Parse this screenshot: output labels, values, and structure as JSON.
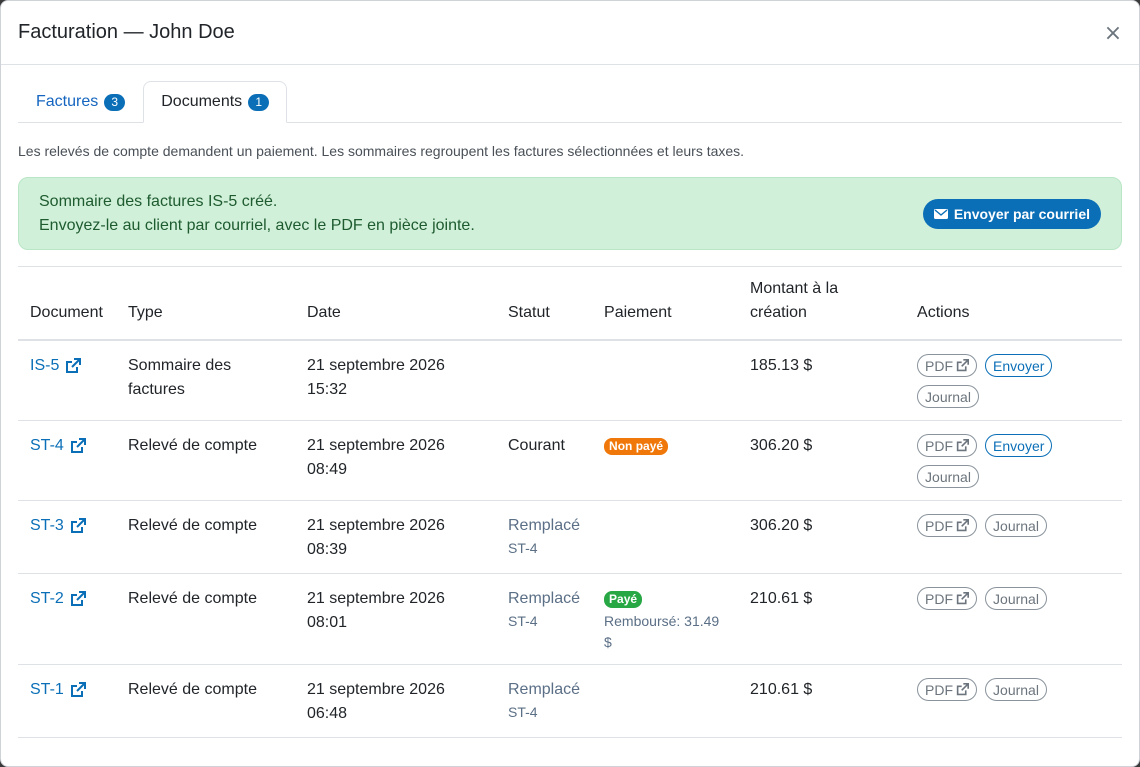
{
  "modal": {
    "title": "Facturation — John Doe",
    "close_label": "×"
  },
  "tabs": [
    {
      "label": "Factures",
      "count": "3"
    },
    {
      "label": "Documents",
      "count": "1"
    }
  ],
  "help_text": "Les relevés de compte demandent un paiement. Les sommaires regroupent les factures sélectionnées et leurs taxes.",
  "alert": {
    "line1": "Sommaire des factures IS-5 créé.",
    "line2": "Envoyez-le au client par courriel, avec le PDF en pièce jointe.",
    "button_label": "Envoyer par courriel"
  },
  "table": {
    "headers": {
      "document": "Document",
      "type": "Type",
      "date": "Date",
      "status": "Statut",
      "payment": "Paiement",
      "amount_line1": "Montant à la",
      "amount_line2": "création",
      "actions": "Actions"
    },
    "rows": [
      {
        "document": "IS-5",
        "type": "Sommaire des factures",
        "date_line1": "21 septembre 2026",
        "date_line2": "15:32",
        "status": "",
        "status_ref": "",
        "payment_badge": "",
        "refund": "",
        "amount": "185.13 $",
        "actions": {
          "pdf": "PDF",
          "send": "Envoyer",
          "journal": "Journal"
        }
      },
      {
        "document": "ST-4",
        "type": "Relevé de compte",
        "date_line1": "21 septembre 2026",
        "date_line2": "08:49",
        "status": "Courant",
        "status_ref": "",
        "payment_badge": "Non payé",
        "refund": "",
        "amount": "306.20 $",
        "actions": {
          "pdf": "PDF",
          "send": "Envoyer",
          "journal": "Journal"
        }
      },
      {
        "document": "ST-3",
        "type": "Relevé de compte",
        "date_line1": "21 septembre 2026",
        "date_line2": "08:39",
        "status": "Remplacé",
        "status_ref": "ST-4",
        "payment_badge": "",
        "refund": "",
        "amount": "306.20 $",
        "actions": {
          "pdf": "PDF",
          "journal": "Journal"
        }
      },
      {
        "document": "ST-2",
        "type": "Relevé de compte",
        "date_line1": "21 septembre 2026",
        "date_line2": "08:01",
        "status": "Remplacé",
        "status_ref": "ST-4",
        "payment_badge": "Payé",
        "refund": "Remboursé: 31.49 $",
        "amount": "210.61 $",
        "actions": {
          "pdf": "PDF",
          "journal": "Journal"
        }
      },
      {
        "document": "ST-1",
        "type": "Relevé de compte",
        "date_line1": "21 septembre 2026",
        "date_line2": "06:48",
        "status": "Remplacé",
        "status_ref": "ST-4",
        "payment_badge": "",
        "refund": "",
        "amount": "210.61 $",
        "actions": {
          "pdf": "PDF",
          "journal": "Journal"
        }
      }
    ]
  },
  "colors": {
    "primary": "#0b6fb7",
    "alert_bg": "#d1f0d9",
    "badge_unpaid": "#f0780a",
    "badge_paid": "#28a745"
  },
  "icons": {
    "close": "close-icon",
    "mail": "envelope-icon",
    "external": "external-link-icon"
  }
}
